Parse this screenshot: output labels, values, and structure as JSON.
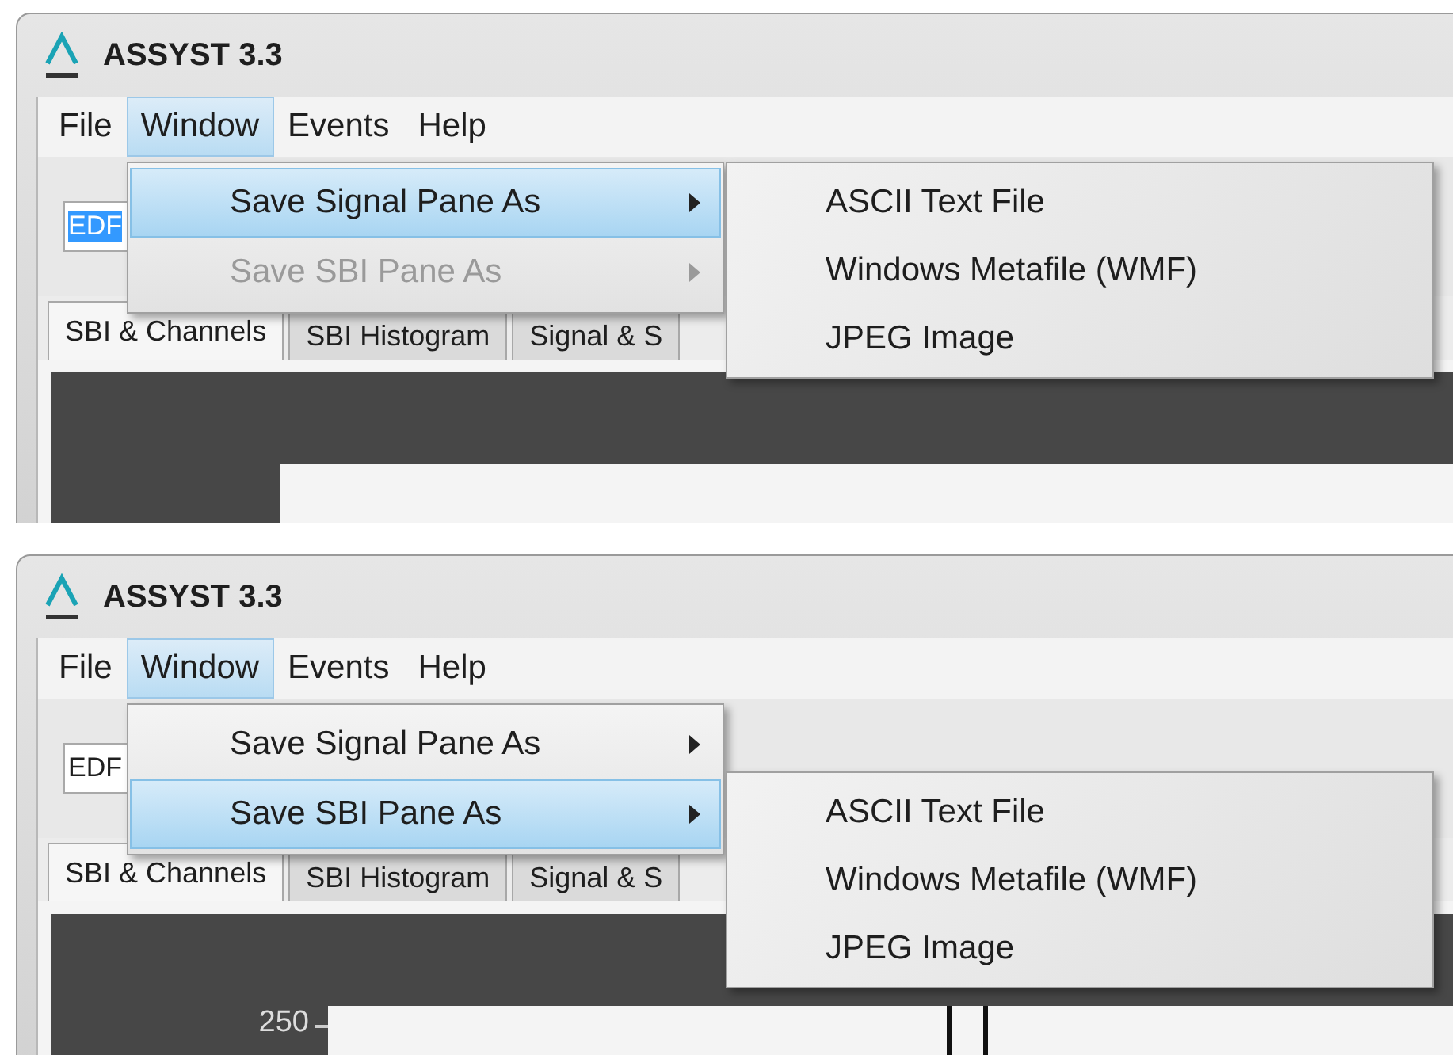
{
  "panels": [
    {
      "window": {
        "title": "ASSYST 3.3"
      },
      "menubar": [
        {
          "label": "File",
          "selected": false
        },
        {
          "label": "Window",
          "selected": true
        },
        {
          "label": "Events",
          "selected": false
        },
        {
          "label": "Help",
          "selected": false
        }
      ],
      "toolbar": {
        "format_field": {
          "value": "EDF",
          "text_selected": true
        }
      },
      "tabs": [
        {
          "label": "SBI & Channels",
          "selected": true
        },
        {
          "label": "SBI Histogram",
          "selected": false
        },
        {
          "label": "Signal & S",
          "selected": false
        }
      ],
      "menu": {
        "items": [
          {
            "label": "Save Signal Pane As",
            "selected": true,
            "disabled": false
          },
          {
            "label": "Save SBI Pane As",
            "selected": false,
            "disabled": true
          }
        ]
      },
      "submenu": {
        "items": [
          {
            "label": "ASCII Text File"
          },
          {
            "label": "Windows Metafile (WMF)"
          },
          {
            "label": "JPEG Image"
          }
        ]
      },
      "plot": {
        "trace_visible": false
      }
    },
    {
      "window": {
        "title": "ASSYST 3.3"
      },
      "menubar": [
        {
          "label": "File",
          "selected": false
        },
        {
          "label": "Window",
          "selected": true
        },
        {
          "label": "Events",
          "selected": false
        },
        {
          "label": "Help",
          "selected": false
        }
      ],
      "toolbar": {
        "format_field": {
          "value": "EDF",
          "text_selected": false
        }
      },
      "tabs": [
        {
          "label": "SBI & Channels",
          "selected": true
        },
        {
          "label": "SBI Histogram",
          "selected": false
        },
        {
          "label": "Signal & S",
          "selected": false
        }
      ],
      "menu": {
        "items": [
          {
            "label": "Save Signal Pane As",
            "selected": false,
            "disabled": false
          },
          {
            "label": "Save SBI Pane As",
            "selected": true,
            "disabled": false
          }
        ]
      },
      "submenu": {
        "items": [
          {
            "label": "ASCII Text File"
          },
          {
            "label": "Windows Metafile (WMF)"
          },
          {
            "label": "JPEG Image"
          }
        ]
      },
      "plot": {
        "y_tick": "250",
        "trace_visible": true
      }
    }
  ]
}
